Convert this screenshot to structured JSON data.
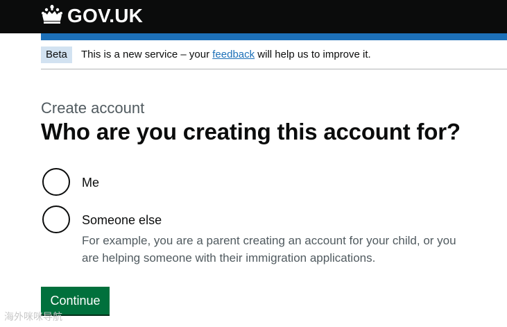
{
  "header": {
    "logo_text": "GOV.UK",
    "logo_icon": "crown-icon"
  },
  "phase_banner": {
    "tag": "Beta",
    "text_before": "This is a new service – your ",
    "link_text": "feedback",
    "text_after": " will help us to improve it."
  },
  "main": {
    "caption": "Create account",
    "heading": "Who are you creating this account for?",
    "options": [
      {
        "label": "Me",
        "checked": false
      },
      {
        "label": "Someone else",
        "checked": false,
        "hint": "For example, you are a parent creating an account for your child, or you are helping someone with their immigration applications."
      }
    ],
    "continue_label": "Continue"
  },
  "watermark": "海外咪咪导航",
  "colors": {
    "header_bg": "#0b0c0c",
    "accent_blue": "#1d70b8",
    "phase_tag_bg": "#d2e2f1",
    "button_green": "#00703c",
    "hint_grey": "#505a5f"
  }
}
